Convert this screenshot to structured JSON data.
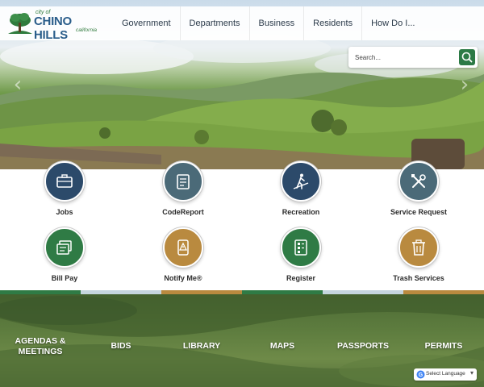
{
  "logo": {
    "city_of": "city of",
    "name": "CHINO HILLS",
    "state": "california"
  },
  "nav": {
    "items": [
      {
        "label": "Government"
      },
      {
        "label": "Departments"
      },
      {
        "label": "Business"
      },
      {
        "label": "Residents"
      },
      {
        "label": "How Do I..."
      }
    ]
  },
  "hero": {
    "prev_arrow": "‹",
    "next_arrow": "›"
  },
  "search": {
    "placeholder": "Search..."
  },
  "quick_icons": [
    {
      "label": "Jobs",
      "icon": "briefcase-icon",
      "color": "#2c4a6a"
    },
    {
      "label": "CodeReport",
      "icon": "clipboard-icon",
      "color": "#4b6a78"
    },
    {
      "label": "Recreation",
      "icon": "hiker-icon",
      "color": "#2c4a6a"
    },
    {
      "label": "Service Request",
      "icon": "tools-icon",
      "color": "#4b6a78"
    },
    {
      "label": "Bill Pay",
      "icon": "bill-icon",
      "color": "#2f7b45"
    },
    {
      "label": "Notify Me®",
      "icon": "notify-icon",
      "color": "#b98a3f"
    },
    {
      "label": "Register",
      "icon": "register-form-icon",
      "color": "#2f7b45"
    },
    {
      "label": "Trash Services",
      "icon": "trash-can-icon",
      "color": "#b98a3f"
    }
  ],
  "strip_colors": [
    "#2f7b45",
    "#c5d5de",
    "#b98a3f",
    "#2f7b45",
    "#c5d5de",
    "#b98a3f"
  ],
  "footer_links": [
    {
      "line1": "AGENDAS &",
      "line2": "MEETINGS"
    },
    {
      "line1": "BIDS"
    },
    {
      "line1": "LIBRARY"
    },
    {
      "line1": "MAPS"
    },
    {
      "line1": "PASSPORTS"
    },
    {
      "line1": "PERMITS"
    }
  ],
  "translate": {
    "label": "Select Language",
    "arrow": "▾"
  }
}
